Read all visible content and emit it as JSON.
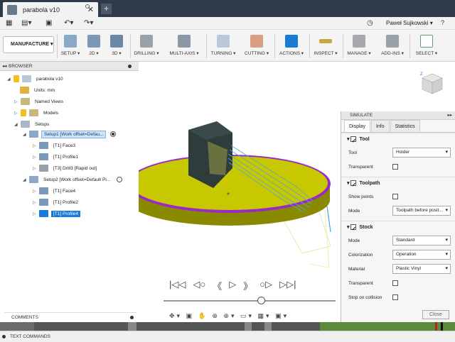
{
  "app": {
    "tab_title": "parabola v10",
    "new_tab": "+",
    "user_name": "Paweł Sujkowski ▾",
    "help": "?"
  },
  "ribbon": {
    "workspace": "MANUFACTURE ▾",
    "groups": [
      "SETUP ▾",
      "2D ▾",
      "3D ▾",
      "DRILLING ▾",
      "MULTI-AXIS ▾",
      "TURNING ▾",
      "CUTTING ▾",
      "ACTIONS ▾",
      "INSPECT ▾",
      "MANAGE ▾",
      "ADD-INS ▾",
      "SELECT ▾"
    ]
  },
  "browser": {
    "header": "BROWSER",
    "root": "parabola v10",
    "units": "Units: mm",
    "named_views": "Named Views",
    "models": "Models",
    "setups": "Setups",
    "setup1": "Setup1 [Work offset=Defau...",
    "setup1_ops": [
      "[T1] Face3",
      "[T1] Profile1",
      "[T3] Drill3 [Rapid out]"
    ],
    "setup2": "Setup2 [Work offset=Default Pi...",
    "setup2_ops": [
      "[T1] Face4",
      "[T1] Profile2",
      "[T1] Profile4"
    ]
  },
  "comments": "COMMENTS",
  "text_commands": "TEXT COMMANDS",
  "simulate": {
    "header": "SIMULATE",
    "tabs": [
      "Display",
      "Info",
      "Statistics"
    ],
    "tool_section": "Tool",
    "tool_label": "Tool",
    "tool_value": "Holder",
    "transparent_label": "Transparent",
    "toolpath_section": "Toolpath",
    "show_points_label": "Show points",
    "mode_label": "Mode",
    "toolpath_mode_value": "Toolpath before posit...",
    "stock_section": "Stock",
    "stock_mode_value": "Standard",
    "colorization_label": "Colorization",
    "colorization_value": "Operation",
    "material_label": "Material",
    "material_value": "Plastic Vinyl",
    "stock_transparent_label": "Transparent",
    "stop_on_collision_label": "Stop on collision",
    "close_label": "Close"
  },
  "viewcube_axis": "Z",
  "colors": {
    "stock": "#c8c800",
    "stock_edge": "#9a2ac8",
    "toolpath": "#4aa8e0",
    "tool": "#2e3c3c",
    "accent": "#1a7ad8"
  }
}
